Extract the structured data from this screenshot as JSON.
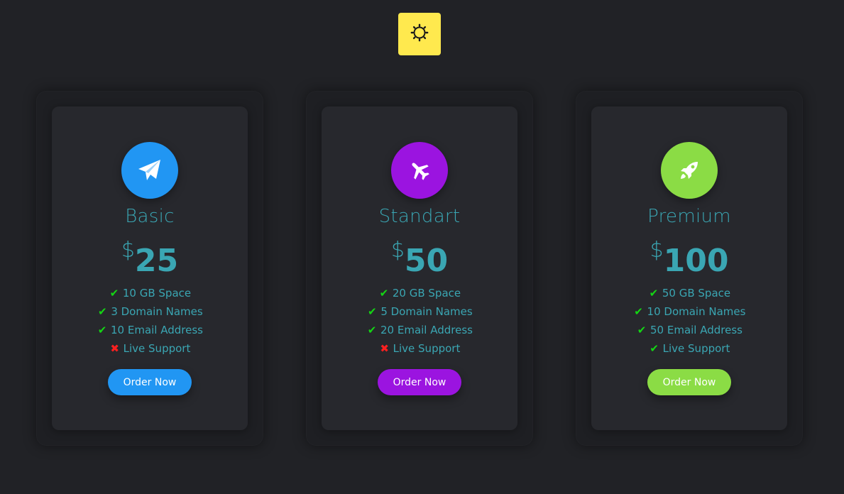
{
  "theme_toggle": {
    "icon": "sun-icon",
    "color": "#ffe94e"
  },
  "plans": [
    {
      "name": "Basic",
      "currency": "$",
      "price": "25",
      "icon": "paper-plane-icon",
      "accent": "#2196f3",
      "features": [
        {
          "text": "10 GB Space",
          "included": true
        },
        {
          "text": "3 Domain Names",
          "included": true
        },
        {
          "text": "10 Email Address",
          "included": true
        },
        {
          "text": "Live Support",
          "included": false
        }
      ],
      "button_label": "Order Now"
    },
    {
      "name": "Standart",
      "currency": "$",
      "price": "50",
      "icon": "airplane-icon",
      "accent": "#9b14e0",
      "features": [
        {
          "text": "20 GB Space",
          "included": true
        },
        {
          "text": "5 Domain Names",
          "included": true
        },
        {
          "text": "20 Email Address",
          "included": true
        },
        {
          "text": "Live Support",
          "included": false
        }
      ],
      "button_label": "Order Now"
    },
    {
      "name": "Premium",
      "currency": "$",
      "price": "100",
      "icon": "rocket-icon",
      "accent": "#8bdc45",
      "features": [
        {
          "text": "50 GB Space",
          "included": true
        },
        {
          "text": "10 Domain Names",
          "included": true
        },
        {
          "text": "50 Email Address",
          "included": true
        },
        {
          "text": "Live Support",
          "included": true
        }
      ],
      "button_label": "Order Now"
    }
  ],
  "colors": {
    "background": "#212226",
    "card": "#27282d",
    "text_accent": "#3aa6b3",
    "check": "#14d614",
    "cross": "#ff1f1f"
  }
}
